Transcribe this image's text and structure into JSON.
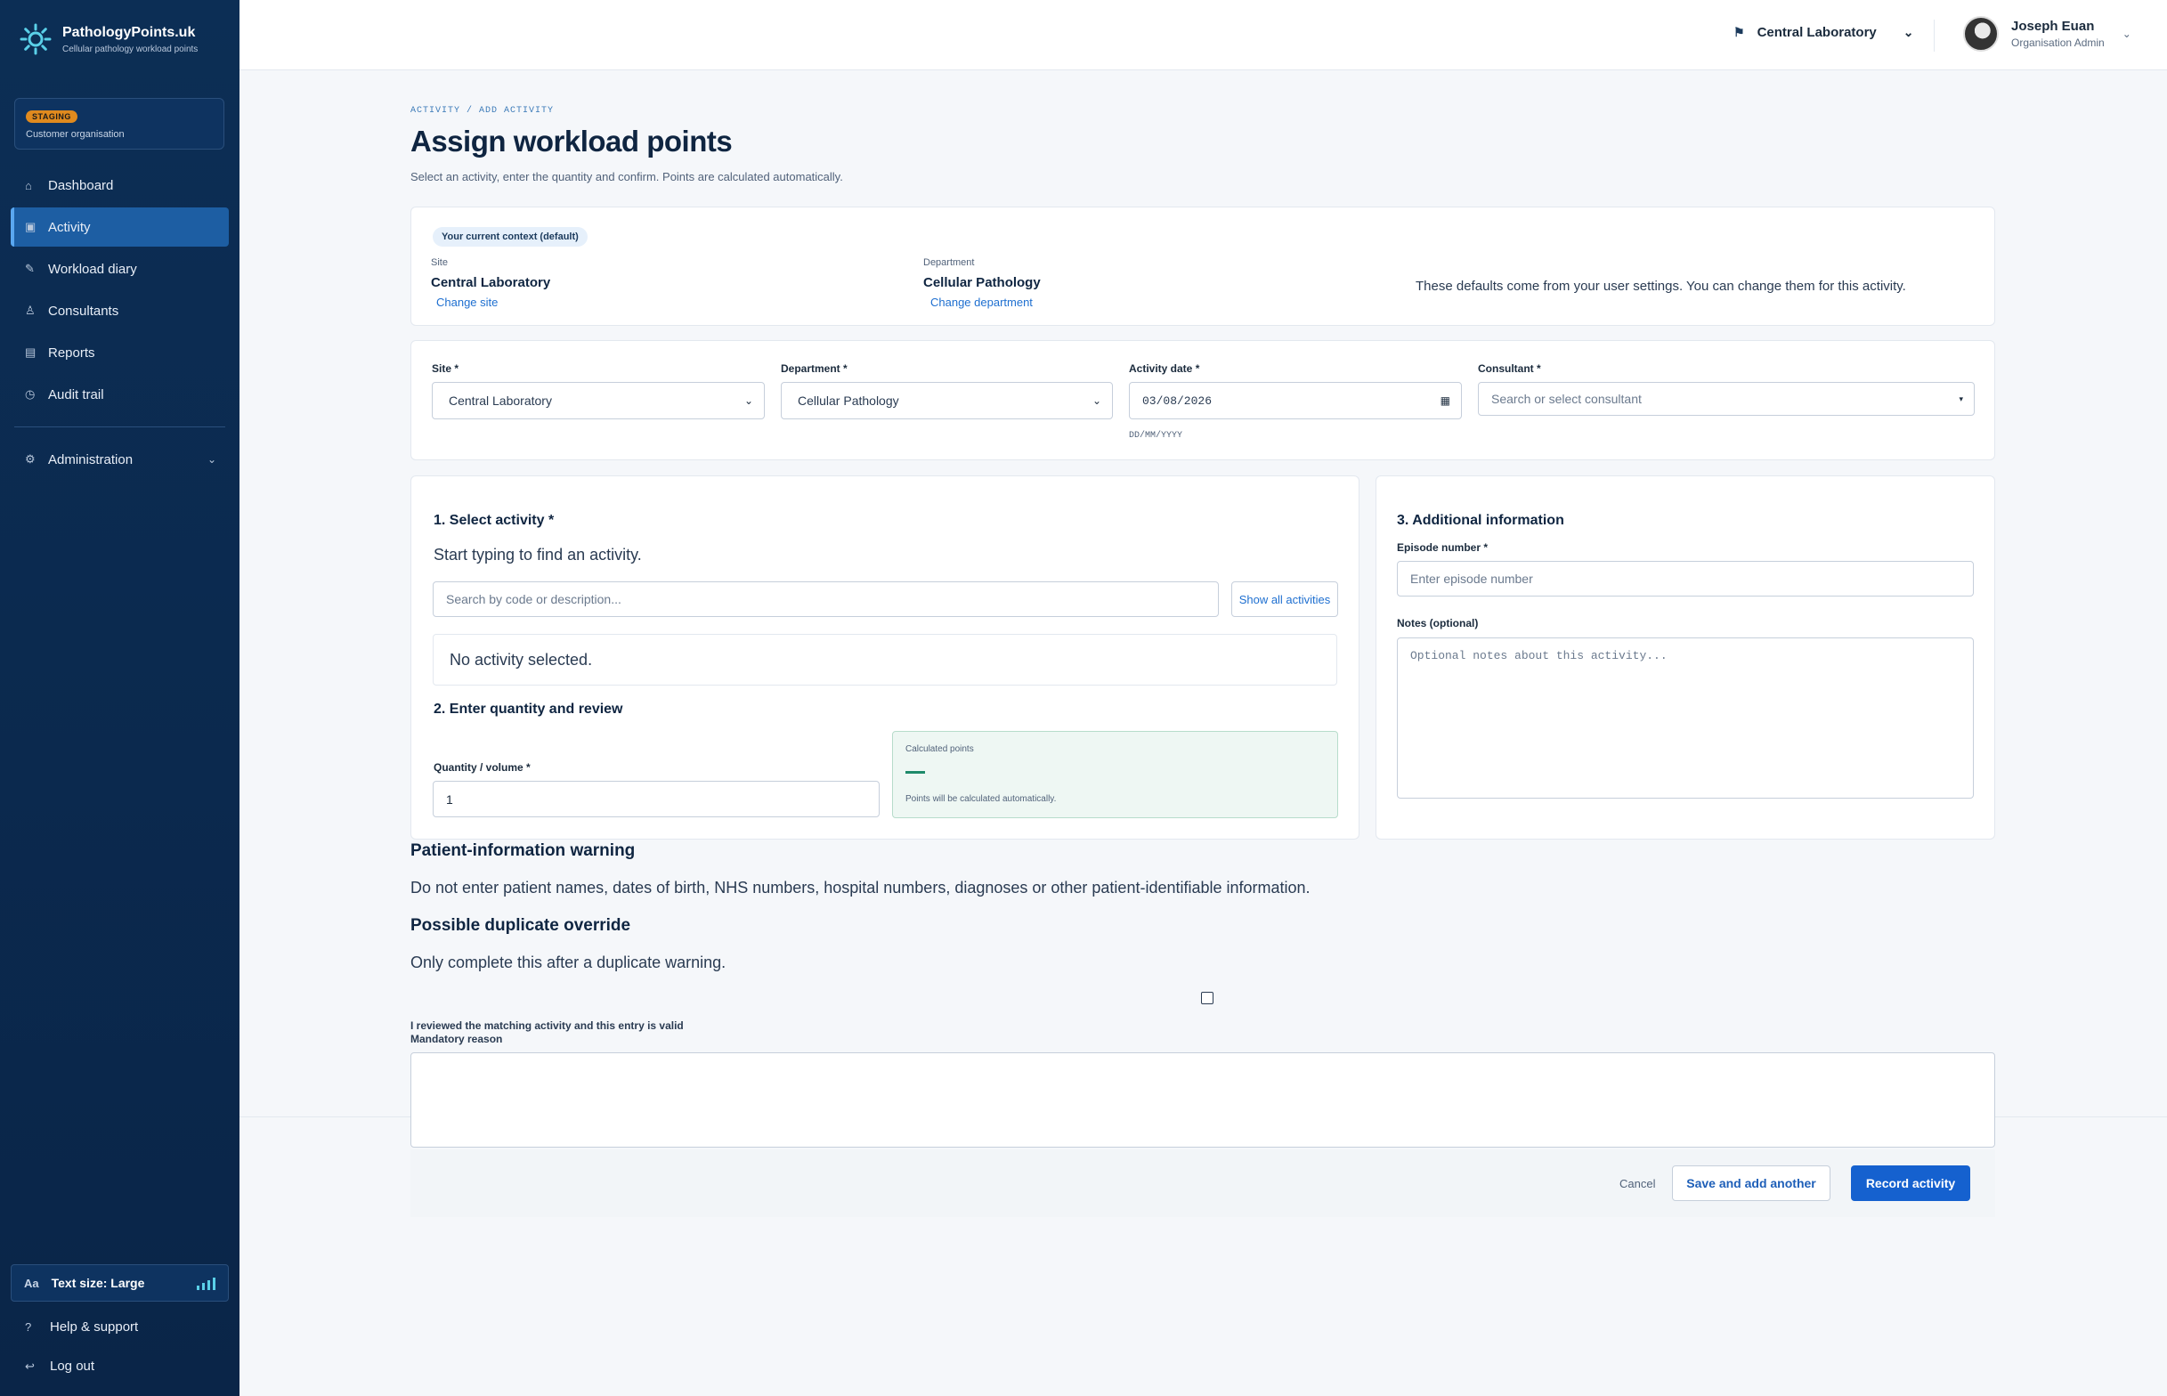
{
  "brand": {
    "name": "PathologyPoints.uk",
    "tagline": "Cellular pathology workload points"
  },
  "environment": {
    "badge": "STAGING",
    "label": "Customer organisation"
  },
  "sidebar": {
    "items": [
      {
        "label": "Dashboard",
        "icon": "home-icon"
      },
      {
        "label": "Activity",
        "icon": "activity-icon",
        "active": true
      },
      {
        "label": "Workload diary",
        "icon": "pen-icon"
      },
      {
        "label": "Consultants",
        "icon": "person-icon"
      },
      {
        "label": "Reports",
        "icon": "reports-icon"
      },
      {
        "label": "Audit trail",
        "icon": "history-icon"
      }
    ],
    "administration": "Administration",
    "text_size": "Text size: Large",
    "text_size_prefix": "Aa",
    "help": "Help & support",
    "logout": "Log out"
  },
  "topbar": {
    "site": "Central Laboratory",
    "user_name": "Joseph Euan",
    "user_role": "Organisation Admin"
  },
  "page": {
    "breadcrumb": "ACTIVITY / ADD ACTIVITY",
    "title": "Assign workload points",
    "subtitle": "Select an activity, enter the quantity and confirm. Points are calculated automatically."
  },
  "context": {
    "badge": "Your current context (default)",
    "site_label": "Site",
    "site_value": "Central Laboratory",
    "site_link": "Change site",
    "dept_label": "Department",
    "dept_value": "Cellular Pathology",
    "dept_link": "Change department",
    "note": "These defaults come from your user settings. You can change them for this activity."
  },
  "filters": {
    "site_label": "Site *",
    "site_value": "Central Laboratory",
    "dept_label": "Department *",
    "dept_value": "Cellular Pathology",
    "date_label": "Activity date *",
    "date_value": "03/08/2026",
    "date_hint": "DD/MM/YYYY",
    "consultant_label": "Consultant *",
    "consultant_placeholder": "Search or select consultant"
  },
  "activity": {
    "section1_title": "1. Select activity *",
    "section1_hint": "Start typing to find an activity.",
    "search_placeholder": "Search by code or description...",
    "show_all": "Show all activities",
    "no_selection": "No activity selected.",
    "section2_title": "2. Enter quantity and review",
    "quantity_label": "Quantity / volume *",
    "quantity_value": "1",
    "calc_label": "Calculated points",
    "calc_note": "Points will be calculated automatically."
  },
  "info": {
    "title": "3. Additional information",
    "episode_label": "Episode number *",
    "episode_placeholder": "Enter episode number",
    "notes_label": "Notes (optional)",
    "notes_placeholder": "Optional notes about this activity..."
  },
  "warnings": {
    "patient_title": "Patient-information warning",
    "patient_text": "Do not enter patient names, dates of birth, NHS numbers, hospital numbers, diagnoses or other patient-identifiable information.",
    "duplicate_title": "Possible duplicate override",
    "duplicate_text": "Only complete this after a duplicate warning.",
    "checkbox_label": "I reviewed the matching activity and this entry is valid",
    "reason_label": "Mandatory reason"
  },
  "actions": {
    "cancel": "Cancel",
    "save_another": "Save and add another",
    "record": "Record activity"
  },
  "colors": {
    "sidebar": "#0c2e55",
    "accent": "#1561cf",
    "active_nav": "#1d5ea3",
    "env_badge": "#e08a1e"
  }
}
